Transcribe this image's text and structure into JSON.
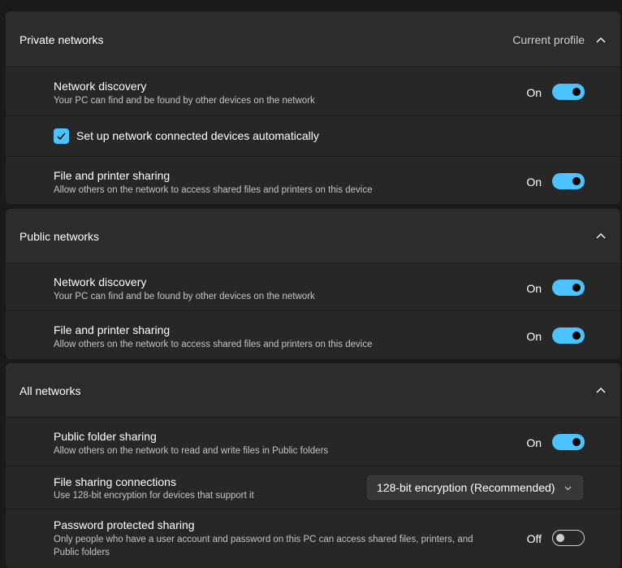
{
  "private": {
    "title": "Private networks",
    "profile": "Current profile",
    "network_discovery": {
      "title": "Network discovery",
      "desc": "Your PC can find and be found by other devices on the network",
      "state": "On"
    },
    "auto_setup": {
      "label": "Set up network connected devices automatically",
      "checked": true
    },
    "file_printer": {
      "title": "File and printer sharing",
      "desc": "Allow others on the network to access shared files and printers on this device",
      "state": "On"
    }
  },
  "public": {
    "title": "Public networks",
    "network_discovery": {
      "title": "Network discovery",
      "desc": "Your PC can find and be found by other devices on the network",
      "state": "On"
    },
    "file_printer": {
      "title": "File and printer sharing",
      "desc": "Allow others on the network to access shared files and printers on this device",
      "state": "On"
    }
  },
  "all": {
    "title": "All networks",
    "public_folder": {
      "title": "Public folder sharing",
      "desc": "Allow others on the network to read and write files in Public folders",
      "state": "On"
    },
    "file_sharing_connections": {
      "title": "File sharing connections",
      "desc": "Use 128-bit encryption for devices that support it",
      "selected": "128-bit encryption (Recommended)"
    },
    "password_sharing": {
      "title": "Password protected sharing",
      "desc_line1": "Only people who have a user account and password on this PC can access shared files, printers, and",
      "desc_line2": "Public folders",
      "state": "Off"
    }
  },
  "colors": {
    "accent": "#4cc2ff",
    "background": "#1a1a1a",
    "card": "#2b2b2b"
  },
  "icons": {
    "collapse": "chevron-up-icon",
    "dropdown": "chevron-down-icon",
    "check": "checkmark-icon"
  }
}
